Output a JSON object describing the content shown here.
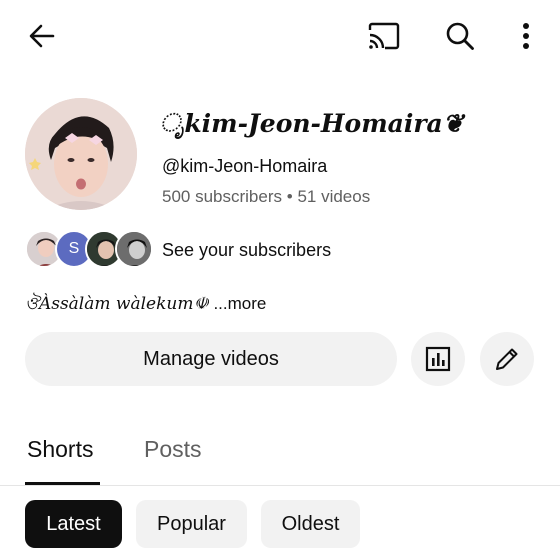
{
  "channel": {
    "name_prefix": "ೃ",
    "name": "kim-Jeon-Homaira",
    "name_suffix": "❦",
    "handle": "@kim-Jeon-Homaira",
    "subscribers": "500 subscribers",
    "separator": "•",
    "videos": "51 videos"
  },
  "subscribers_row": {
    "label": "See your subscribers",
    "avatar_letter": "S",
    "avatar_letter_color": "#5c6bc0"
  },
  "description": {
    "text": "ঔÀssàlàm wàlekum☫",
    "more": "...more"
  },
  "actions": {
    "manage_videos": "Manage videos"
  },
  "tabs": [
    {
      "label": "Shorts",
      "active": true
    },
    {
      "label": "Posts",
      "active": false
    }
  ],
  "chips": [
    {
      "label": "Latest",
      "selected": true
    },
    {
      "label": "Popular",
      "selected": false
    },
    {
      "label": "Oldest",
      "selected": false
    }
  ],
  "icons": {
    "back": "arrow-left-icon",
    "cast": "cast-icon",
    "search": "search-icon",
    "more": "more-vert-icon",
    "analytics": "bar-chart-icon",
    "edit": "pencil-icon"
  },
  "colors": {
    "text": "#0f0f0f",
    "secondary": "#606060",
    "button_bg": "#f2f2f2",
    "chip_selected_bg": "#0f0f0f"
  }
}
